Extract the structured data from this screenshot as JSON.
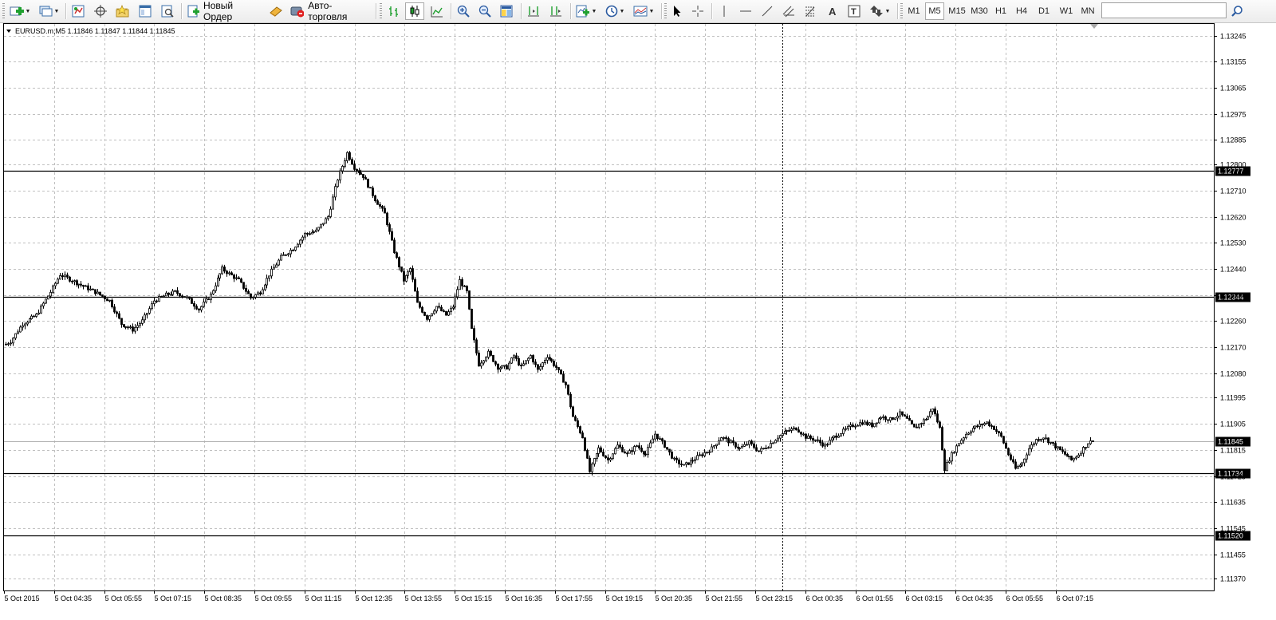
{
  "toolbar": {
    "new_order_label": "Новый Ордер",
    "autotrading_label": "Авто-торговля",
    "timeframes": [
      "M1",
      "M5",
      "M15",
      "M30",
      "H1",
      "H4",
      "D1",
      "W1",
      "MN"
    ],
    "active_timeframe": "M5",
    "search_value": ""
  },
  "chart": {
    "info": "EURUSD.m,M5  1.11846 1.11847 1.11844 1.11845",
    "colors": {
      "candle": "#000000",
      "background": "#ffffff",
      "grid": "#c0c0c0",
      "label_bg": "#000000",
      "label_text": "#ffffff"
    },
    "price_labels": [
      "1.13245",
      "1.13155",
      "1.13065",
      "1.12975",
      "1.12885",
      "1.12800",
      "1.12710",
      "1.12620",
      "1.12530",
      "1.12440",
      "1.12350",
      "1.12260",
      "1.12170",
      "1.12080",
      "1.11995",
      "1.11905",
      "1.11815",
      "1.11725",
      "1.11635",
      "1.11545",
      "1.11455",
      "1.11370"
    ],
    "time_labels": [
      "5 Oct 2015",
      "5 Oct 04:35",
      "5 Oct 05:55",
      "5 Oct 07:15",
      "5 Oct 08:35",
      "5 Oct 09:55",
      "5 Oct 11:15",
      "5 Oct 12:35",
      "5 Oct 13:55",
      "5 Oct 15:15",
      "5 Oct 16:35",
      "5 Oct 17:55",
      "5 Oct 19:15",
      "5 Oct 20:35",
      "5 Oct 21:55",
      "5 Oct 23:15",
      "6 Oct 00:35",
      "6 Oct 01:55",
      "6 Oct 03:15",
      "6 Oct 04:35",
      "6 Oct 05:55",
      "6 Oct 07:15"
    ],
    "horizontal_lines": [
      {
        "label": "1.12777",
        "price": 1.12777
      },
      {
        "label": "1.12344",
        "price": 1.12344
      },
      {
        "label": "1.11734",
        "price": 1.11734
      },
      {
        "label": "1.11520",
        "price": 1.1152
      }
    ],
    "bid_label": "1.11845",
    "bid_price": 1.11845
  },
  "chart_data": {
    "type": "candlestick",
    "symbol": "EURUSD.m",
    "timeframe": "M5",
    "ylim": [
      1.1133,
      1.13285
    ],
    "path": [
      [
        0,
        1.1218
      ],
      [
        2,
        1.1219
      ],
      [
        7,
        1.1225
      ],
      [
        13,
        1.1228
      ],
      [
        19,
        1.1236
      ],
      [
        23,
        1.1242
      ],
      [
        28,
        1.124
      ],
      [
        33,
        1.1238
      ],
      [
        38,
        1.1236
      ],
      [
        44,
        1.1233
      ],
      [
        49,
        1.1225
      ],
      [
        54,
        1.1223
      ],
      [
        58,
        1.1226
      ],
      [
        63,
        1.1233
      ],
      [
        68,
        1.1235
      ],
      [
        72,
        1.1236
      ],
      [
        77,
        1.1234
      ],
      [
        82,
        1.123
      ],
      [
        87,
        1.1235
      ],
      [
        92,
        1.1244
      ],
      [
        99,
        1.124
      ],
      [
        104,
        1.1234
      ],
      [
        108,
        1.1236
      ],
      [
        112,
        1.1242
      ],
      [
        117,
        1.1248
      ],
      [
        122,
        1.1251
      ],
      [
        127,
        1.1256
      ],
      [
        132,
        1.1257
      ],
      [
        137,
        1.1262
      ],
      [
        141,
        1.1275
      ],
      [
        145,
        1.1284
      ],
      [
        148,
        1.1279
      ],
      [
        152,
        1.1276
      ],
      [
        157,
        1.1268
      ],
      [
        161,
        1.1263
      ],
      [
        165,
        1.125
      ],
      [
        169,
        1.124
      ],
      [
        172,
        1.1244
      ],
      [
        175,
        1.1232
      ],
      [
        179,
        1.1227
      ],
      [
        183,
        1.1231
      ],
      [
        187,
        1.1228
      ],
      [
        190,
        1.1231
      ],
      [
        193,
        1.124
      ],
      [
        196,
        1.1236
      ],
      [
        198,
        1.1223
      ],
      [
        201,
        1.1211
      ],
      [
        205,
        1.1215
      ],
      [
        209,
        1.121
      ],
      [
        213,
        1.121
      ],
      [
        216,
        1.1214
      ],
      [
        219,
        1.121
      ],
      [
        223,
        1.1214
      ],
      [
        226,
        1.1209
      ],
      [
        230,
        1.1214
      ],
      [
        234,
        1.121
      ],
      [
        238,
        1.1204
      ],
      [
        241,
        1.1193
      ],
      [
        245,
        1.1186
      ],
      [
        248,
        1.1174
      ],
      [
        252,
        1.1182
      ],
      [
        256,
        1.1178
      ],
      [
        260,
        1.1183
      ],
      [
        264,
        1.118
      ],
      [
        268,
        1.1183
      ],
      [
        272,
        1.118
      ],
      [
        276,
        1.1187
      ],
      [
        280,
        1.1183
      ],
      [
        284,
        1.1178
      ],
      [
        288,
        1.1176
      ],
      [
        292,
        1.1178
      ],
      [
        296,
        1.118
      ],
      [
        300,
        1.1182
      ],
      [
        304,
        1.1186
      ],
      [
        308,
        1.1184
      ],
      [
        312,
        1.1182
      ],
      [
        316,
        1.1184
      ],
      [
        320,
        1.1181
      ],
      [
        324,
        1.1183
      ],
      [
        328,
        1.1186
      ],
      [
        332,
        1.1188
      ],
      [
        336,
        1.1189
      ],
      [
        340,
        1.1186
      ],
      [
        344,
        1.1185
      ],
      [
        348,
        1.1183
      ],
      [
        352,
        1.1186
      ],
      [
        356,
        1.1188
      ],
      [
        360,
        1.119
      ],
      [
        364,
        1.1191
      ],
      [
        368,
        1.119
      ],
      [
        372,
        1.1193
      ],
      [
        376,
        1.1192
      ],
      [
        380,
        1.1194
      ],
      [
        383,
        1.1192
      ],
      [
        386,
        1.1189
      ],
      [
        389,
        1.1191
      ],
      [
        392,
        1.1193
      ],
      [
        394,
        1.1196
      ],
      [
        397,
        1.1189
      ],
      [
        399,
        1.1175
      ],
      [
        402,
        1.118
      ],
      [
        405,
        1.1184
      ],
      [
        408,
        1.1187
      ],
      [
        411,
        1.1189
      ],
      [
        414,
        1.119
      ],
      [
        417,
        1.1191
      ],
      [
        420,
        1.1189
      ],
      [
        423,
        1.1186
      ],
      [
        426,
        1.118
      ],
      [
        429,
        1.1175
      ],
      [
        432,
        1.1177
      ],
      [
        435,
        1.1182
      ],
      [
        438,
        1.1185
      ],
      [
        441,
        1.1186
      ],
      [
        444,
        1.1184
      ],
      [
        447,
        1.1182
      ],
      [
        450,
        1.118
      ],
      [
        453,
        1.1178
      ],
      [
        456,
        1.118
      ],
      [
        458,
        1.1182
      ],
      [
        460,
        1.1184
      ],
      [
        462,
        1.11845
      ]
    ]
  }
}
